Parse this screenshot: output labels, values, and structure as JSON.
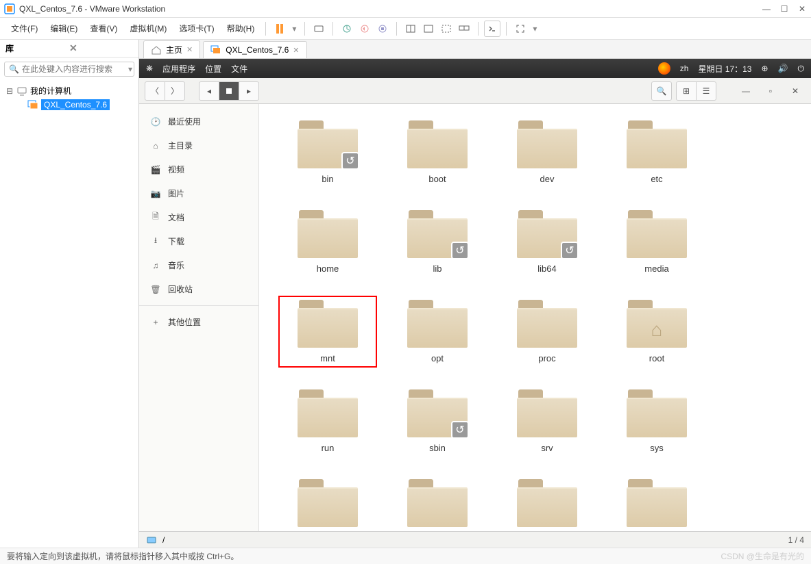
{
  "titlebar": {
    "title": "QXL_Centos_7.6 - VMware Workstation"
  },
  "menubar": {
    "file": "文件(F)",
    "edit": "编辑(E)",
    "view": "查看(V)",
    "vm": "虚拟机(M)",
    "tabs": "选项卡(T)",
    "help": "帮助(H)"
  },
  "library": {
    "title": "库",
    "search_placeholder": "在此处键入内容进行搜索",
    "root": "我的计算机",
    "vm": "QXL_Centos_7.6"
  },
  "vmtabs": {
    "home": "主页",
    "vm": "QXL_Centos_7.6"
  },
  "guest_top": {
    "apps": "应用程序",
    "places": "位置",
    "files": "文件",
    "lang": "zh",
    "datetime": "星期日 17：13"
  },
  "fm_sidebar": {
    "recent": "最近使用",
    "home": "主目录",
    "video": "视频",
    "pictures": "图片",
    "documents": "文档",
    "downloads": "下载",
    "music": "音乐",
    "trash": "回收站",
    "other": "其他位置"
  },
  "folders": [
    {
      "name": "bin",
      "link": true
    },
    {
      "name": "boot"
    },
    {
      "name": "dev"
    },
    {
      "name": "etc"
    },
    {
      "name": "home"
    },
    {
      "name": "lib",
      "link": true
    },
    {
      "name": "lib64",
      "link": true
    },
    {
      "name": "media"
    },
    {
      "name": "mnt",
      "highlight": true
    },
    {
      "name": "opt"
    },
    {
      "name": "proc"
    },
    {
      "name": "root",
      "home": true
    },
    {
      "name": "run"
    },
    {
      "name": "sbin",
      "link": true
    },
    {
      "name": "srv"
    },
    {
      "name": "sys"
    },
    {
      "name": ""
    },
    {
      "name": ""
    },
    {
      "name": ""
    },
    {
      "name": ""
    }
  ],
  "fm_status": {
    "path": "/",
    "page": "1 / 4"
  },
  "footer": {
    "hint": "要将输入定向到该虚拟机，请将鼠标指针移入其中或按 Ctrl+G。",
    "watermark": "CSDN @生命是有光的"
  }
}
